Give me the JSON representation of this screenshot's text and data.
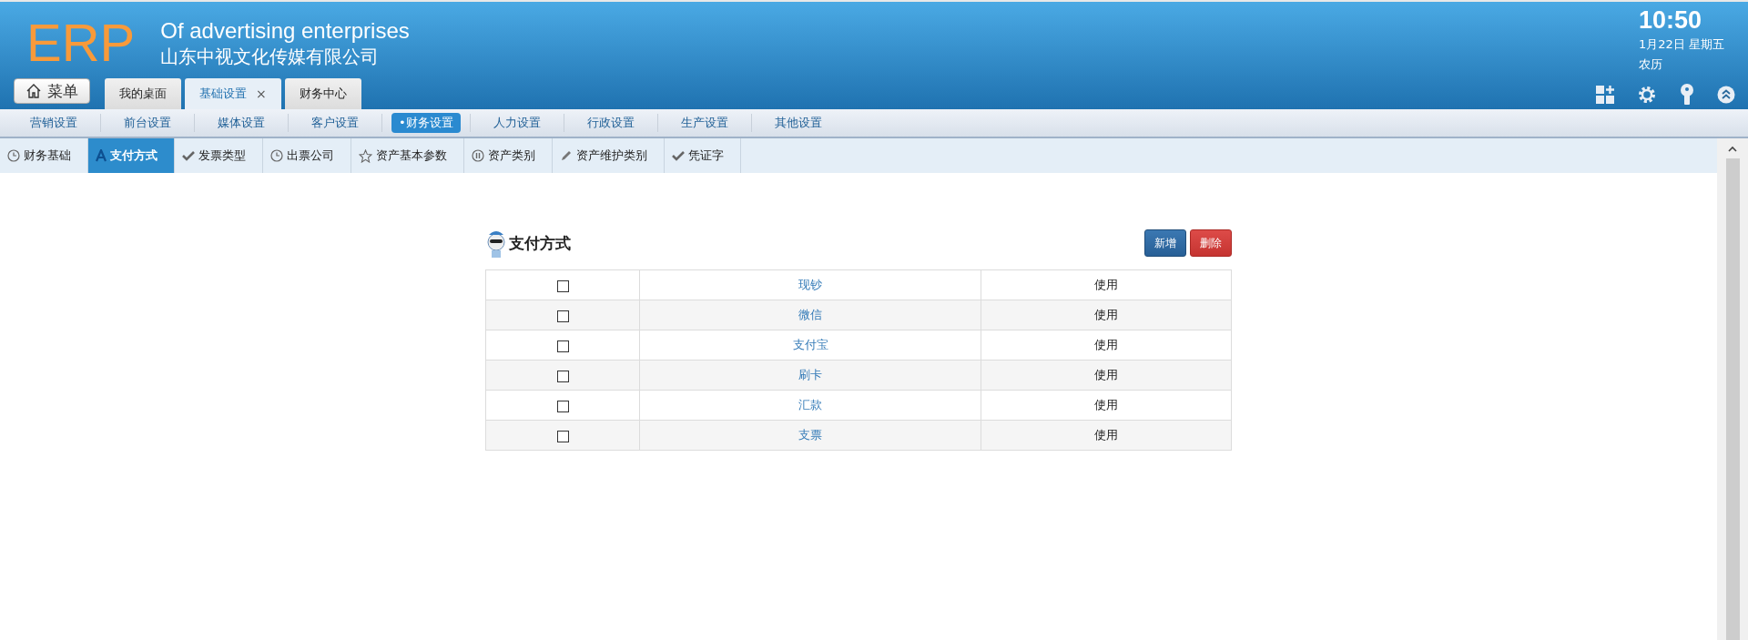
{
  "header": {
    "logo": "ERP",
    "title": "Of advertising enterprises",
    "company": "山东中视文化传媒有限公司",
    "menu_button": "菜单",
    "time": "10:50",
    "date": "1月22日 星期五",
    "lunar": "农历"
  },
  "tabs": [
    {
      "label": "我的桌面",
      "selected": false,
      "closable": false
    },
    {
      "label": "基础设置",
      "selected": true,
      "closable": true
    },
    {
      "label": "财务中心",
      "selected": false,
      "closable": false
    }
  ],
  "close_label": "×",
  "nav": [
    {
      "label": "营销设置",
      "selected": false
    },
    {
      "label": "前台设置",
      "selected": false
    },
    {
      "label": "媒体设置",
      "selected": false
    },
    {
      "label": "客户设置",
      "selected": false
    },
    {
      "label": "•财务设置",
      "selected": true
    },
    {
      "label": "人力设置",
      "selected": false
    },
    {
      "label": "行政设置",
      "selected": false
    },
    {
      "label": "生产设置",
      "selected": false
    },
    {
      "label": "其他设置",
      "selected": false
    }
  ],
  "subnav": [
    {
      "label": "财务基础",
      "kind": "clock",
      "selected": false
    },
    {
      "label": "支付方式",
      "kind": "letter",
      "selected": true
    },
    {
      "label": "发票类型",
      "kind": "check",
      "selected": false
    },
    {
      "label": "出票公司",
      "kind": "clock",
      "selected": false
    },
    {
      "label": "资产基本参数",
      "kind": "star",
      "selected": false
    },
    {
      "label": "资产类别",
      "kind": "pause",
      "selected": false
    },
    {
      "label": "资产维护类别",
      "kind": "pencil",
      "selected": false
    },
    {
      "label": "凭证字",
      "kind": "check",
      "selected": false
    }
  ],
  "panel": {
    "title": "支付方式",
    "buttons": [
      {
        "label": "新增",
        "kind": "primary"
      },
      {
        "label": "删除",
        "kind": "danger"
      }
    ]
  },
  "rows": [
    {
      "checked": false,
      "name": "现钞",
      "status": "使用"
    },
    {
      "checked": false,
      "name": "微信",
      "status": "使用"
    },
    {
      "checked": false,
      "name": "支付宝",
      "status": "使用"
    },
    {
      "checked": false,
      "name": "刷卡",
      "status": "使用"
    },
    {
      "checked": false,
      "name": "汇款",
      "status": "使用"
    },
    {
      "checked": false,
      "name": "支票",
      "status": "使用"
    }
  ]
}
